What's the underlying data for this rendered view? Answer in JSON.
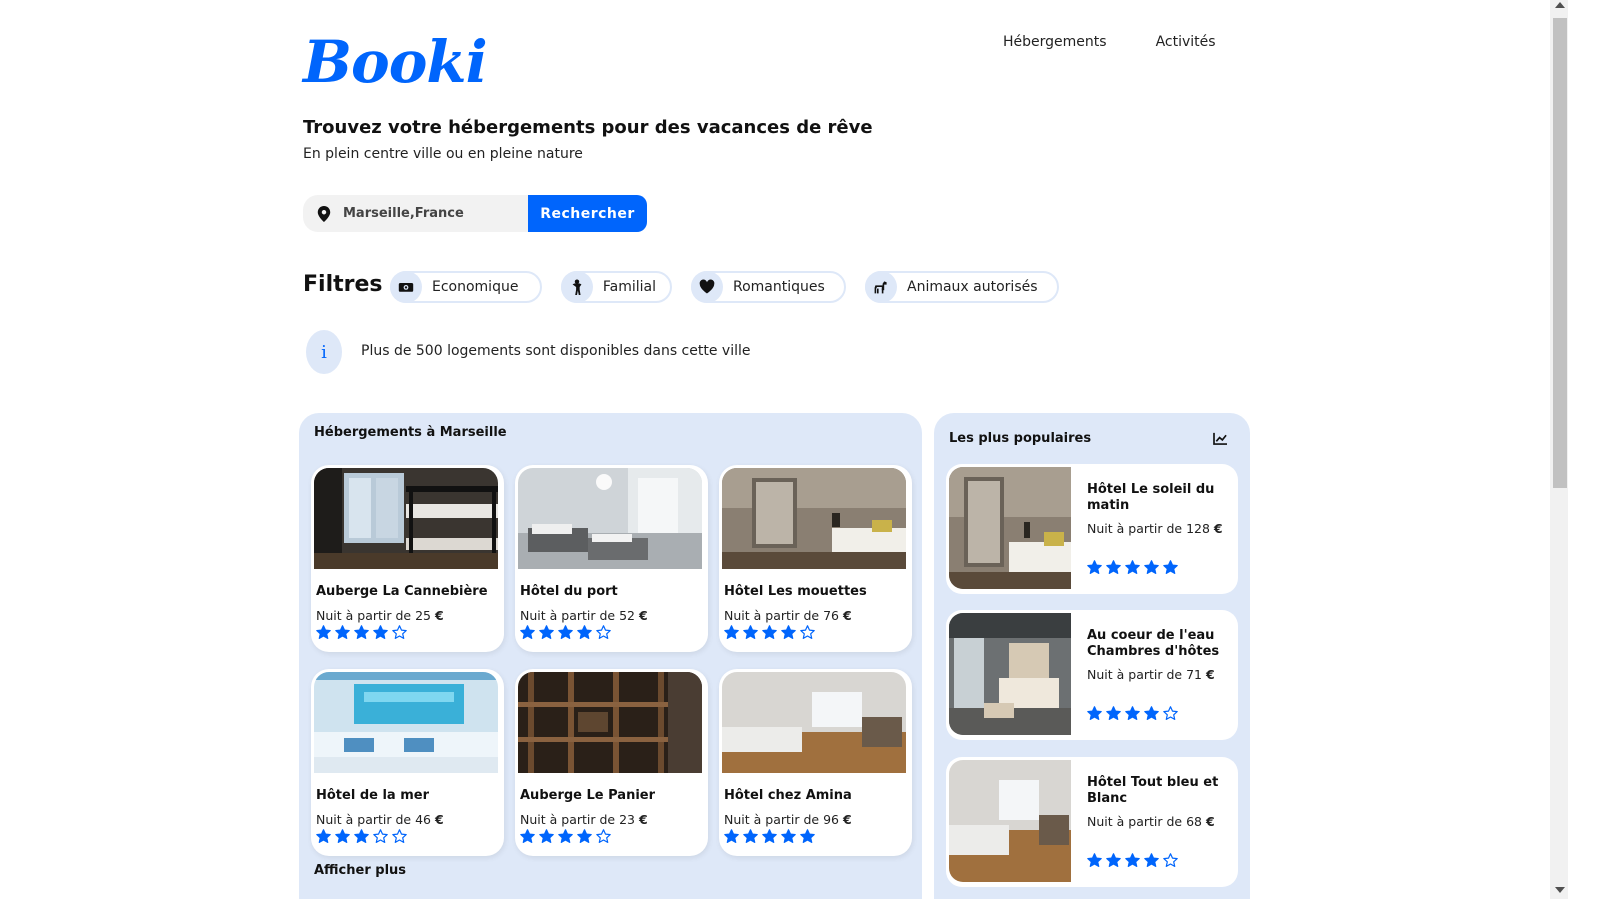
{
  "brand": {
    "logo": "Booki",
    "color": "#0065FC"
  },
  "nav": {
    "items": [
      "Hébergements",
      "Activités"
    ]
  },
  "hero": {
    "title": "Trouvez votre hébergements pour des vacances de rêve",
    "subtitle": "En plein centre ville ou en pleine nature"
  },
  "search": {
    "icon": "location-pin-icon",
    "value": "Marseille,France",
    "button_label": "Rechercher"
  },
  "filters": {
    "label": "Filtres",
    "items": [
      {
        "label": "Economique",
        "icon": "money-icon"
      },
      {
        "label": "Familial",
        "icon": "child-icon"
      },
      {
        "label": "Romantiques",
        "icon": "heart-icon"
      },
      {
        "label": "Animaux autorisés",
        "icon": "dog-icon"
      }
    ]
  },
  "info": {
    "icon_text": "i",
    "text": "Plus de 500 logements sont disponibles dans cette ville"
  },
  "accommodations": {
    "title": "Hébergements à Marseille",
    "price_prefix": "Nuit à partir de",
    "currency": "€",
    "items": [
      {
        "name": "Auberge La Cannebière",
        "price": "Nuit à partir de 25",
        "rating": 4
      },
      {
        "name": "Hôtel du port",
        "price": "Nuit à partir de 52",
        "rating": 4
      },
      {
        "name": "Hôtel Les mouettes",
        "price": "Nuit à partir de 76",
        "rating": 4
      },
      {
        "name": "Hôtel de la mer",
        "price": "Nuit à partir de 46",
        "rating": 3
      },
      {
        "name": "Auberge Le Panier",
        "price": "Nuit à partir de 23",
        "rating": 4
      },
      {
        "name": "Hôtel chez Amina",
        "price": "Nuit à partir de 96",
        "rating": 5
      }
    ],
    "show_more": "Afficher plus"
  },
  "popular": {
    "title": "Les plus populaires",
    "icon": "chart-line-icon",
    "items": [
      {
        "name": "Hôtel Le soleil du matin",
        "price": "Nuit à partir de 128",
        "rating": 5
      },
      {
        "name": "Au coeur de l'eau Chambres d'hôtes",
        "price": "Nuit à partir de 71",
        "rating": 4
      },
      {
        "name": "Hôtel Tout bleu et Blanc",
        "price": "Nuit à partir de 68",
        "rating": 4
      }
    ]
  },
  "colors": {
    "accent": "#0065FC",
    "panel_bg": "#DEE8F8",
    "chip_border": "#DEE8F8"
  }
}
